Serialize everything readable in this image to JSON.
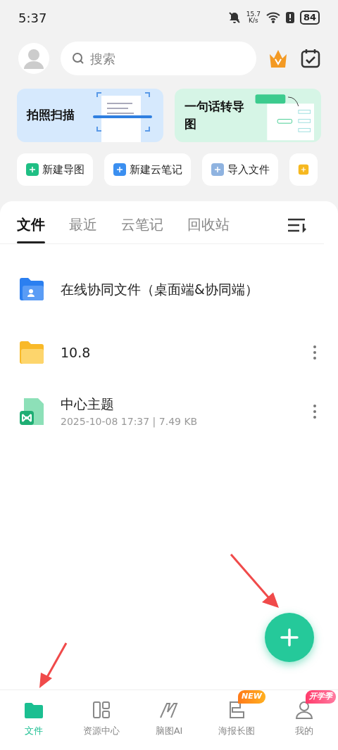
{
  "status_bar": {
    "time": "5:37",
    "speed_value": "15.7",
    "speed_unit": "K/s",
    "battery": "84"
  },
  "search": {
    "placeholder": "搜索"
  },
  "promo_cards": [
    {
      "kind": "scan",
      "title": "拍照扫描"
    },
    {
      "kind": "mindmap",
      "title": "一句话转导图"
    }
  ],
  "quick_actions": [
    {
      "kind": "mindmap",
      "label": "新建导图"
    },
    {
      "kind": "note",
      "label": "新建云笔记"
    },
    {
      "kind": "import",
      "label": "导入文件"
    },
    {
      "kind": "template"
    }
  ],
  "tabs": [
    {
      "label": "文件",
      "selected": true
    },
    {
      "label": "最近",
      "selected": false
    },
    {
      "label": "云笔记",
      "selected": false
    },
    {
      "label": "回收站",
      "selected": false
    }
  ],
  "files": [
    {
      "kind": "shared-folder",
      "name": "在线协同文件（桌面端&协同端）"
    },
    {
      "kind": "folder",
      "name": "10.8"
    },
    {
      "kind": "mindmap",
      "name": "中心主题",
      "meta": "2025-10-08 17:37 | 7.49 KB"
    }
  ],
  "bottom_nav": [
    {
      "kind": "files",
      "label": "文件",
      "selected": true
    },
    {
      "kind": "resources",
      "label": "资源中心",
      "selected": false
    },
    {
      "kind": "ai",
      "label": "脑图AI",
      "selected": false
    },
    {
      "kind": "poster",
      "label": "海报长图",
      "selected": false,
      "badge": "NEW"
    },
    {
      "kind": "me",
      "label": "我的",
      "selected": false,
      "badge": "开学季"
    }
  ]
}
